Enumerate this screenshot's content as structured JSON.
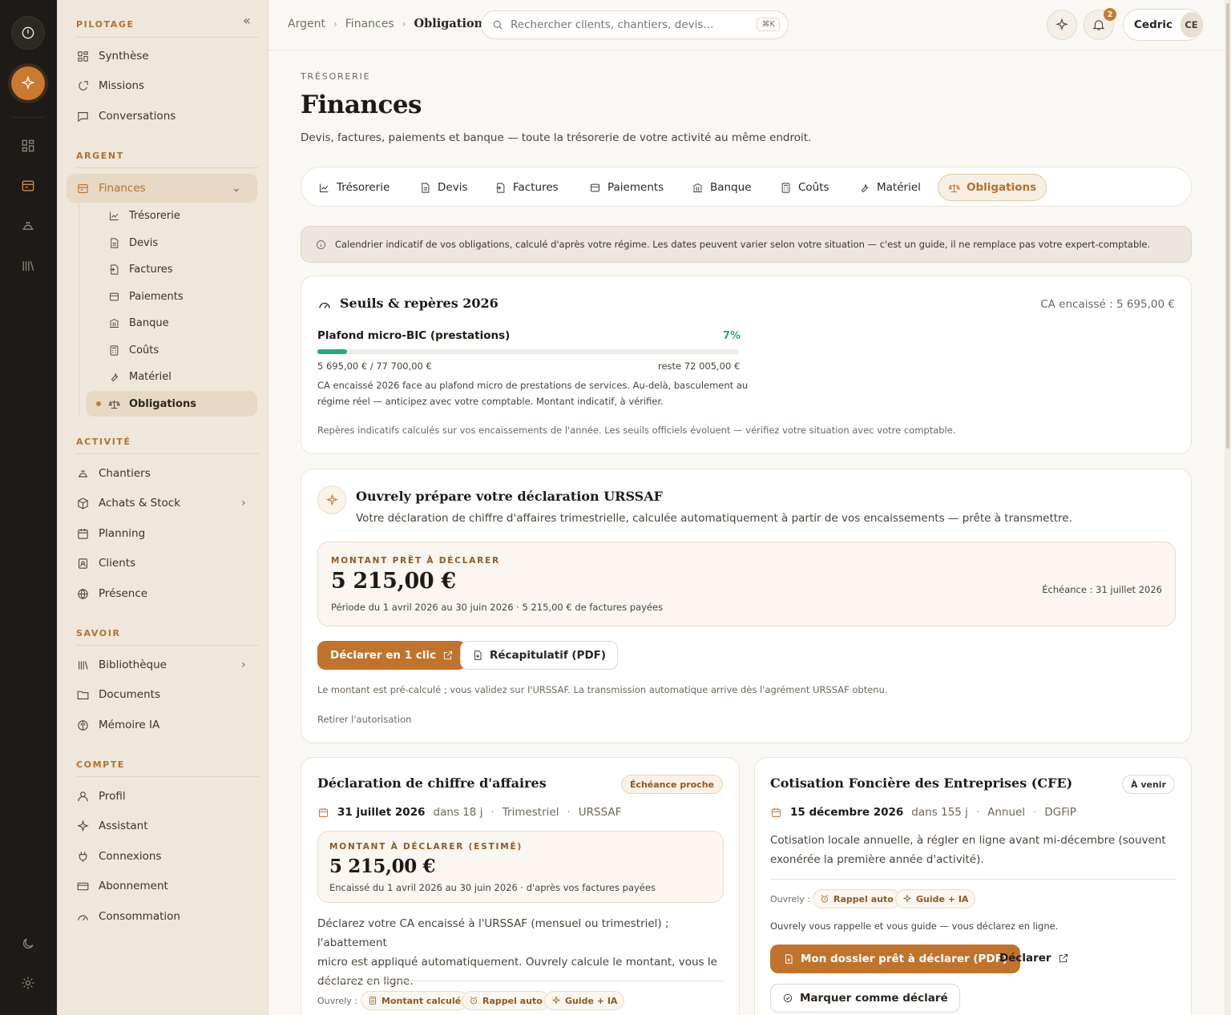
{
  "sidebar": {
    "sections": {
      "pilotage": "PILOTAGE",
      "argent": "ARGENT",
      "activite": "ACTIVITÉ",
      "savoir": "SAVOIR",
      "compte": "COMPTE"
    },
    "pilotage": [
      "Synthèse",
      "Missions",
      "Conversations"
    ],
    "finances": "Finances",
    "finances_sub": [
      "Trésorerie",
      "Devis",
      "Factures",
      "Paiements",
      "Banque",
      "Coûts",
      "Matériel",
      "Obligations"
    ],
    "activite": [
      "Chantiers",
      "Achats & Stock",
      "Planning",
      "Clients",
      "Présence"
    ],
    "savoir": [
      "Bibliothèque",
      "Documents",
      "Mémoire IA"
    ],
    "compte": [
      "Profil",
      "Assistant",
      "Connexions",
      "Abonnement",
      "Consommation"
    ]
  },
  "topbar": {
    "crumbs": [
      "Argent",
      "Finances",
      "Obligations"
    ],
    "search_placeholder": "Rechercher clients, chantiers, devis...",
    "search_kbd": "⌘K",
    "notif_count": "2",
    "user_name": "Cedric",
    "user_initials": "CE"
  },
  "header": {
    "eyebrow": "TRÉSORERIE",
    "title": "Finances",
    "lede": "Devis, factures, paiements et banque — toute la trésorerie de votre activité au même endroit."
  },
  "tabs": [
    "Trésorerie",
    "Devis",
    "Factures",
    "Paiements",
    "Banque",
    "Coûts",
    "Matériel",
    "Obligations"
  ],
  "info": "Calendrier indicatif de vos obligations, calculé d'après votre régime. Les dates peuvent varier selon votre situation — c'est un guide, il ne remplace pas votre expert-comptable.",
  "seuils": {
    "title": "Seuils & repères 2026",
    "ca": "CA encaissé : 5 695,00 €",
    "plafond_label": "Plafond micro-BIC (prestations)",
    "percent_label": "7%",
    "progress_fraction": 0.07,
    "left_value": "5 695,00 € / 77 700,00 €",
    "right_value": "reste 72 005,00 €",
    "desc1": "CA encaissé 2026 face au plafond micro de prestations de services. Au-delà, basculement au",
    "desc2": "régime réel — anticipez avec votre comptable. Montant indicatif, à vérifier.",
    "foot": "Repères indicatifs calculés sur vos encaissements de l'année. Les seuils officiels évoluent — vérifiez votre situation avec votre comptable."
  },
  "urssaf": {
    "title": "Ouvrely prépare votre déclaration URSSAF",
    "subtitle": "Votre déclaration de chiffre d'affaires trimestrielle, calculée automatiquement à partir de vos encaissements — prête à transmettre.",
    "amount_label": "MONTANT PRÊT À DÉCLARER",
    "amount": "5 215,00 €",
    "period": "Période du 1 avril 2026 au 30 juin 2026 · 5 215,00 € de factures payées",
    "due": "Échéance : 31 juillet 2026",
    "btn_declare": "Déclarer en 1 clic",
    "btn_pdf": "Récapitulatif (PDF)",
    "note": "Le montant est pré-calculé ; vous validez sur l'URSSAF. La transmission automatique arrive dès l'agrément URSSAF obtenu.",
    "revoke": "Retirer l'autorisation"
  },
  "ca_decl": {
    "title": "Déclaration de chiffre d'affaires",
    "badge": "Échéance proche",
    "date": "31 juillet 2026",
    "in_days": "dans 18 j",
    "freq": "Trimestriel",
    "org": "URSSAF",
    "amount_label": "MONTANT À DÉCLARER (ESTIMÉ)",
    "amount": "5 215,00 €",
    "amount_note": "Encaissé du 1 avril 2026 au 30 juin 2026 · d'après vos factures payées",
    "desc": [
      "Déclarez votre CA encaissé à l'URSSAF (mensuel ou trimestriel) ; l'abattement",
      "micro est appliqué automatiquement. Ouvrely calcule le montant, vous le",
      "déclarez en ligne."
    ],
    "ouvrely_label": "Ouvrely :",
    "chips": [
      "Montant calculé",
      "Rappel auto",
      "Guide + IA"
    ]
  },
  "cfe": {
    "title": "Cotisation Foncière des Entreprises (CFE)",
    "badge": "À venir",
    "date": "15 décembre 2026",
    "in_days": "dans 155 j",
    "freq": "Annuel",
    "org": "DGFiP",
    "desc": [
      "Cotisation locale annuelle, à régler en ligne avant mi-décembre (souvent",
      "exonérée la première année d'activité)."
    ],
    "ouvrely_label": "Ouvrely :",
    "chips": [
      "Rappel auto",
      "Guide + IA"
    ],
    "note": "Ouvrely vous rappelle et vous guide — vous déclarez en ligne.",
    "btn_pdf": "Mon dossier prêt à déclarer (PDF)",
    "btn_declare": "Déclarer",
    "btn_mark": "Marquer comme déclaré"
  }
}
